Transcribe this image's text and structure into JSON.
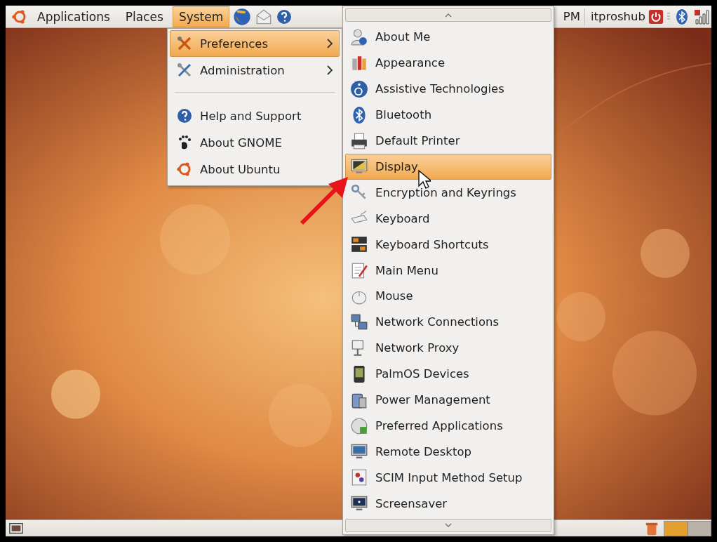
{
  "top_panel": {
    "menus": [
      {
        "label": "Applications",
        "selected": false
      },
      {
        "label": "Places",
        "selected": false
      },
      {
        "label": "System",
        "selected": true
      }
    ],
    "clock": "PM",
    "user": "itproshub"
  },
  "system_menu": {
    "items": [
      {
        "kind": "submenu",
        "label": "Preferences",
        "selected": true
      },
      {
        "kind": "submenu",
        "label": "Administration",
        "selected": false
      },
      {
        "kind": "separator"
      },
      {
        "kind": "item",
        "label": "Help and Support",
        "selected": false
      },
      {
        "kind": "item",
        "label": "About GNOME",
        "selected": false
      },
      {
        "kind": "item",
        "label": "About Ubuntu",
        "selected": false
      }
    ]
  },
  "preferences_menu": {
    "items": [
      {
        "label": "About Me",
        "selected": false
      },
      {
        "label": "Appearance",
        "selected": false
      },
      {
        "label": "Assistive Technologies",
        "selected": false
      },
      {
        "label": "Bluetooth",
        "selected": false
      },
      {
        "label": "Default Printer",
        "selected": false
      },
      {
        "label": "Display",
        "selected": true
      },
      {
        "label": "Encryption and Keyrings",
        "selected": false
      },
      {
        "label": "Keyboard",
        "selected": false
      },
      {
        "label": "Keyboard Shortcuts",
        "selected": false
      },
      {
        "label": "Main Menu",
        "selected": false
      },
      {
        "label": "Mouse",
        "selected": false
      },
      {
        "label": "Network Connections",
        "selected": false
      },
      {
        "label": "Network Proxy",
        "selected": false
      },
      {
        "label": "PalmOS Devices",
        "selected": false
      },
      {
        "label": "Power Management",
        "selected": false
      },
      {
        "label": "Preferred Applications",
        "selected": false
      },
      {
        "label": "Remote Desktop",
        "selected": false
      },
      {
        "label": "SCIM Input Method Setup",
        "selected": false
      },
      {
        "label": "Screensaver",
        "selected": false
      }
    ]
  },
  "bottom_panel": {
    "workspaces": [
      {
        "selected": true
      },
      {
        "selected": false
      }
    ]
  }
}
